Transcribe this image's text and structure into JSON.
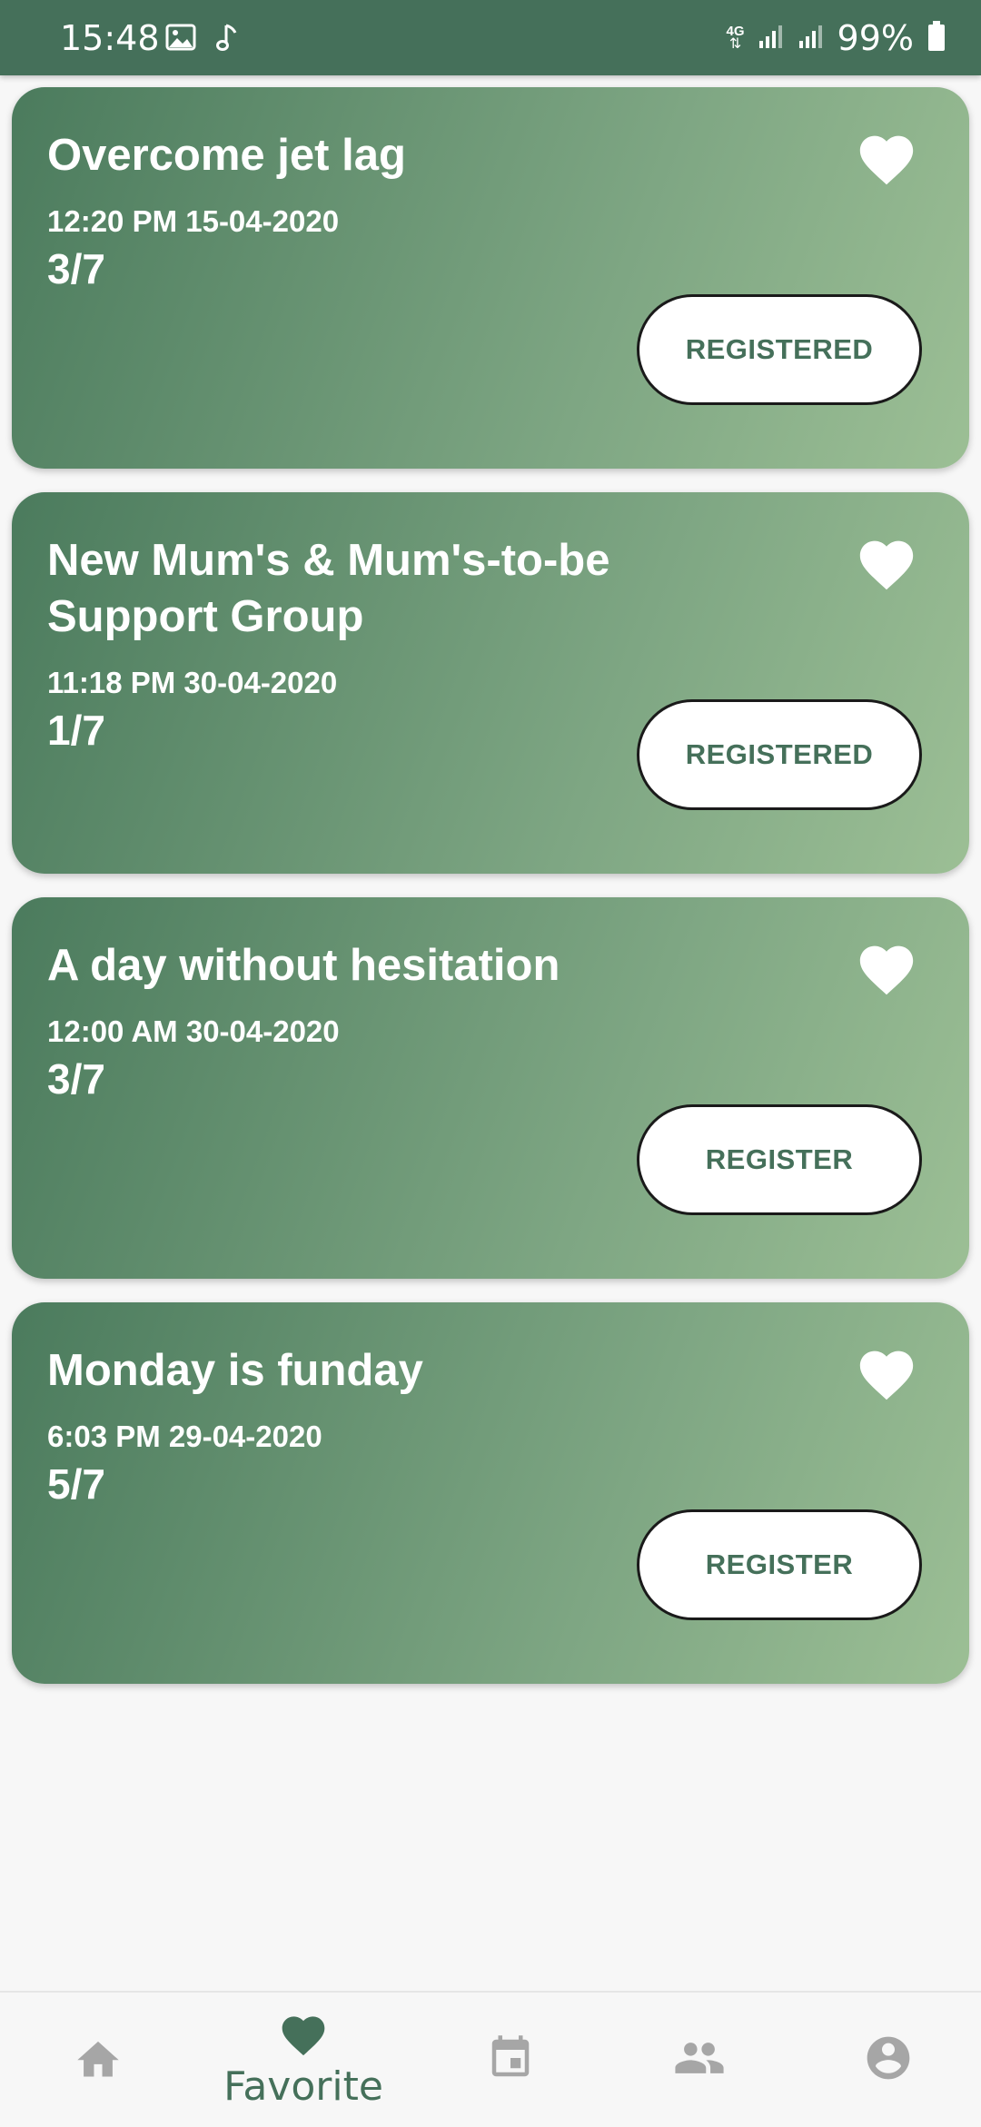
{
  "status_bar": {
    "time": "15:48",
    "network": "4G",
    "battery": "99%",
    "icons": [
      "image-icon",
      "music-note-icon",
      "network-4g-icon",
      "signal-icon",
      "signal-icon",
      "battery-icon"
    ]
  },
  "cards": [
    {
      "title": "Overcome jet lag",
      "datetime": "12:20 PM 15-04-2020",
      "count": "3/7",
      "button": "REGISTERED",
      "favorite": true
    },
    {
      "title": "New Mum's & Mum's-to-be Support Group",
      "datetime": "11:18 PM 30-04-2020",
      "count": "1/7",
      "button": "REGISTERED",
      "favorite": true
    },
    {
      "title": "A day without hesitation",
      "datetime": "12:00 AM 30-04-2020",
      "count": "3/7",
      "button": "REGISTER",
      "favorite": true
    },
    {
      "title": "Monday is funday",
      "datetime": "6:03 PM 29-04-2020",
      "count": "5/7",
      "button": "REGISTER",
      "favorite": true
    }
  ],
  "bottom_nav": {
    "active_label": "Favorite",
    "items": [
      {
        "icon": "home-icon"
      },
      {
        "icon": "heart-icon",
        "label": "Favorite",
        "active": true
      },
      {
        "icon": "calendar-icon"
      },
      {
        "icon": "people-icon"
      },
      {
        "icon": "account-icon"
      }
    ]
  },
  "colors": {
    "primary": "#45705a",
    "card_gradient_start": "#4b7b5d",
    "card_gradient_end": "#9cbf95",
    "nav_inactive": "#a6a6a6",
    "background": "#f7f7f7"
  }
}
